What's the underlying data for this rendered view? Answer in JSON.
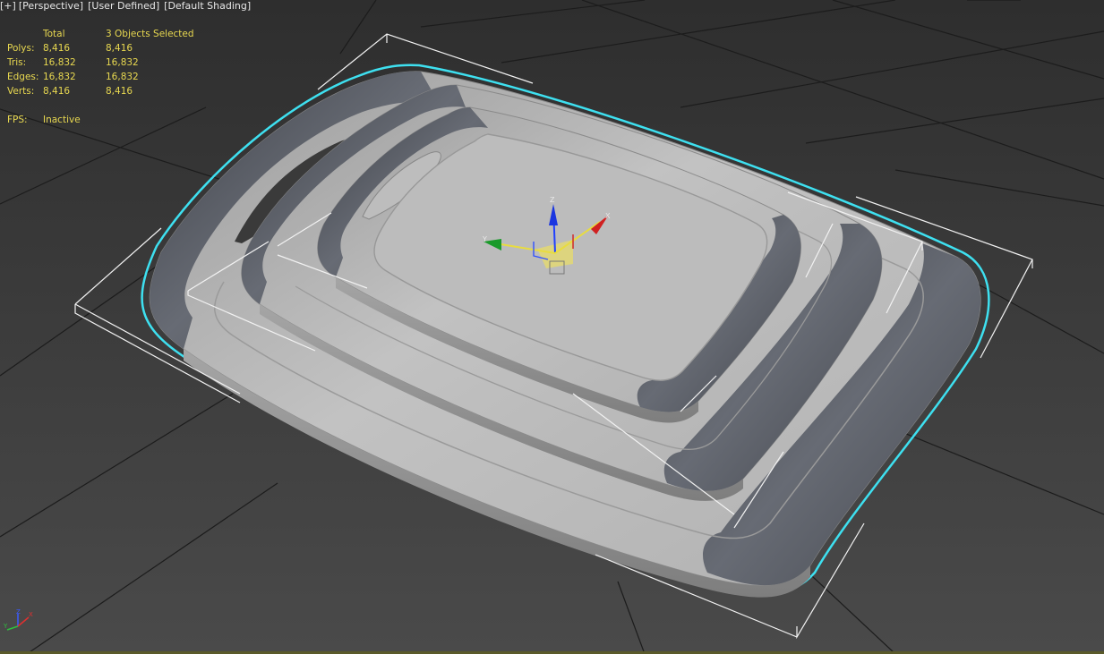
{
  "viewport": {
    "labels": [
      "[+]",
      "[Perspective]",
      "[User Defined]",
      "[Default Shading]"
    ]
  },
  "stats": {
    "header": {
      "total": "Total",
      "selected": "3 Objects Selected"
    },
    "rows": [
      {
        "label": "Polys:",
        "total": "8,416",
        "selected": "8,416"
      },
      {
        "label": "Tris:",
        "total": "16,832",
        "selected": "16,832"
      },
      {
        "label": "Edges:",
        "total": "16,832",
        "selected": "16,832"
      },
      {
        "label": "Verts:",
        "total": "8,416",
        "selected": "8,416"
      }
    ],
    "fps": {
      "label": "FPS:",
      "value": "Inactive"
    }
  },
  "gizmo": {
    "z": "Z",
    "y": "Y",
    "x": "X"
  },
  "corner_axis": {
    "z": "Z",
    "y": "Y",
    "x": "X"
  },
  "colors": {
    "background": "#3b3b3b",
    "grid": "#1a1a1a",
    "stats_text": "#e8d850",
    "selection_outline": "#3ee0f0",
    "board_light": "#b9b9b9",
    "board_dark": "#545860",
    "bbox": "#f2f2f2"
  },
  "icons": [
    "view-cube-none",
    "transform-gizmo-icon",
    "world-axis-icon"
  ]
}
